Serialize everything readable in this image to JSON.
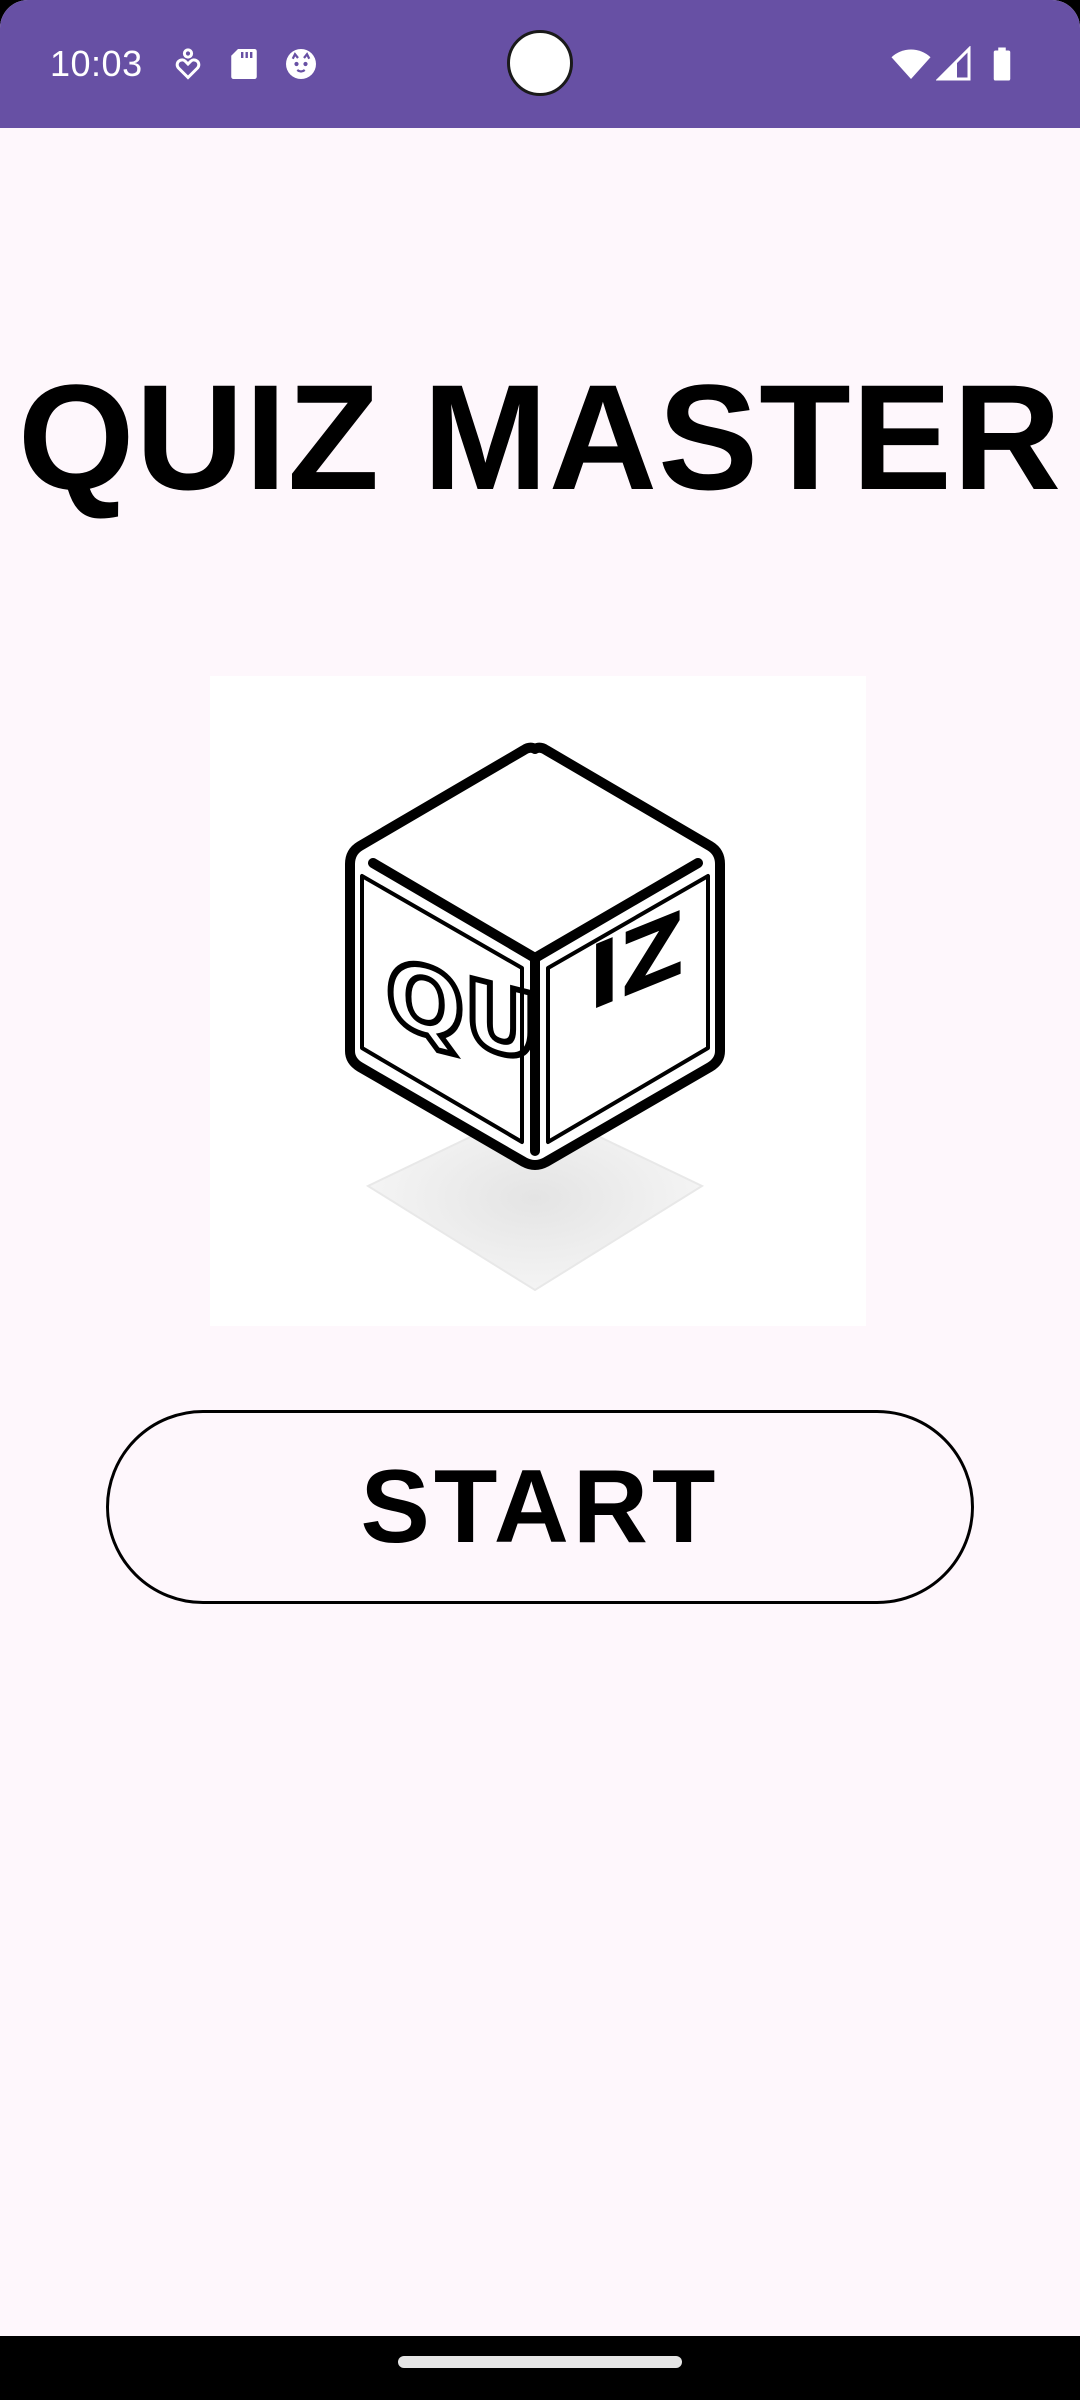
{
  "status_bar": {
    "time": "10:03",
    "left_icons": [
      "accessibility-icon",
      "sd-card-icon",
      "cat-face-icon"
    ],
    "right_icons": [
      "wifi-icon",
      "cell-signal-icon",
      "battery-icon"
    ],
    "background_color": "#6750A4"
  },
  "main": {
    "title": "QUIZ MASTER",
    "logo": {
      "icon": "quiz-cube-logo",
      "lettering": [
        "QU",
        "IZ"
      ]
    },
    "start_button_label": "START"
  },
  "colors": {
    "accent": "#6750A4",
    "background": "#FEF7FC",
    "text": "#000000"
  }
}
